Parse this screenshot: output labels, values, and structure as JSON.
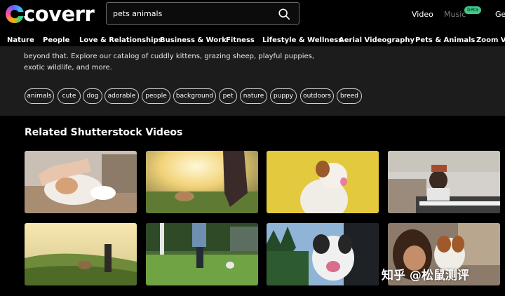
{
  "header": {
    "logo_text": "coverr",
    "search": {
      "value": "pets animals",
      "placeholder": ""
    },
    "nav": {
      "video": "Video",
      "music": "Music",
      "music_badge": "beta",
      "cut": "Ge"
    }
  },
  "categories": [
    "Nature",
    "People",
    "Love & Relationships",
    "Business & Work",
    "Fitness",
    "Lifestyle & Wellness",
    "Aerial Videography",
    "Pets & Animals",
    "Zoom Vir"
  ],
  "description": {
    "line1": "beyond that. Explore our catalog of cuddly kittens, grazing sheep, playful puppies,",
    "line2": "exotic wildlife, and more."
  },
  "tags": [
    "animals",
    "cute",
    "dog",
    "adorable",
    "people",
    "background",
    "pet",
    "nature",
    "puppy",
    "outdoors",
    "breed"
  ],
  "related": {
    "title": "Related Shutterstock Videos"
  },
  "watermark": "知乎 @松鼠测评",
  "colors": {
    "background": "#000000",
    "section": "#1c1c1c",
    "beta_badge": "#3ec98b"
  }
}
